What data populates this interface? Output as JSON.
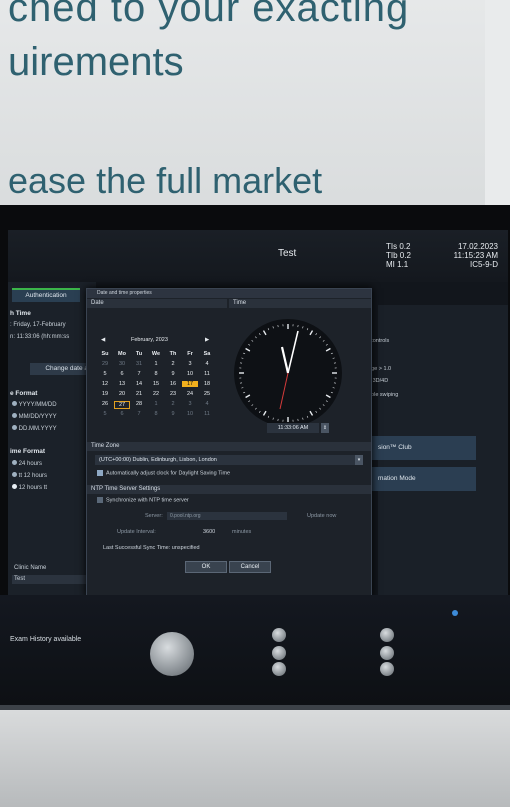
{
  "poster": {
    "line1": "ched to your exacting",
    "line2": "uirements",
    "line3": "ease the full market"
  },
  "header": {
    "title": "Test",
    "tis_label": "TIs",
    "tis_value": "0.2",
    "tib_label": "TIb",
    "tib_value": "0.2",
    "mi_label": "MI",
    "mi_value": "1.1",
    "date": "17.02.2023",
    "time": "11:15:23 AM",
    "probe": "IC5-9-D"
  },
  "left_panel": {
    "auth_button": "Authentication",
    "time_heading": "h Time",
    "date_line": ":  Friday, 17-February",
    "time_line": "n:  11:33:06 (hh:mm:ss",
    "change_button": "Change date a",
    "format_heading": "e Format",
    "date_formats": [
      "YYYY/MM/DD",
      "MM/DD/YYYY",
      "DD.MM.YYYY"
    ],
    "time_format_heading": "ime Format",
    "time_formats": [
      "24 hours",
      "tt 12 hours",
      "12 hours tt"
    ],
    "clinic_label": "Clinic Name",
    "clinic_value": "Test"
  },
  "right_panel": {
    "controls": "controls",
    "age_line": "age > 1.0",
    "mode_line": "n 3D/4D",
    "swipe_line": "able swiping",
    "club_button": "sion™ Club",
    "automation_button": "mation Mode"
  },
  "dialog": {
    "title": "Date and time properties",
    "date_section": "Date",
    "time_section": "Time",
    "month_label": "February, 2023",
    "weekdays": [
      "Su",
      "Mo",
      "Tu",
      "We",
      "Th",
      "Fr",
      "Sa"
    ],
    "weeks": [
      [
        "29",
        "30",
        "31",
        "1",
        "2",
        "3",
        "4"
      ],
      [
        "5",
        "6",
        "7",
        "8",
        "9",
        "10",
        "11"
      ],
      [
        "12",
        "13",
        "14",
        "15",
        "16",
        "17",
        "18"
      ],
      [
        "19",
        "20",
        "21",
        "22",
        "23",
        "24",
        "25"
      ],
      [
        "26",
        "27",
        "28",
        "1",
        "2",
        "3",
        "4"
      ],
      [
        "5",
        "6",
        "7",
        "8",
        "9",
        "10",
        "11"
      ]
    ],
    "selected_day": "17",
    "time_value": "11:33:06 AM",
    "timezone_section": "Time Zone",
    "timezone_value": "(UTC+00:00) Dublin, Edinburgh, Lisbon, London",
    "dst_label": "Automatically adjust clock for Daylight Saving Time",
    "ntp_section": "NTP Time Server Settings",
    "ntp_sync_label": "Synchronize with NTP time server",
    "server_label": "Server:",
    "server_value": "0.pool.ntp.org",
    "update_now": "Update now",
    "interval_label": "Update Interval:",
    "interval_value": "3600",
    "interval_unit": "minutes",
    "last_sync": "Last Successful Sync Time: unspecified",
    "ok": "OK",
    "cancel": "Cancel"
  },
  "console": {
    "exam_history": "Exam History available"
  },
  "colors": {
    "accent_green": "#3bb54a",
    "selected_day": "#f2b01e",
    "poster_text": "#2f6170"
  }
}
